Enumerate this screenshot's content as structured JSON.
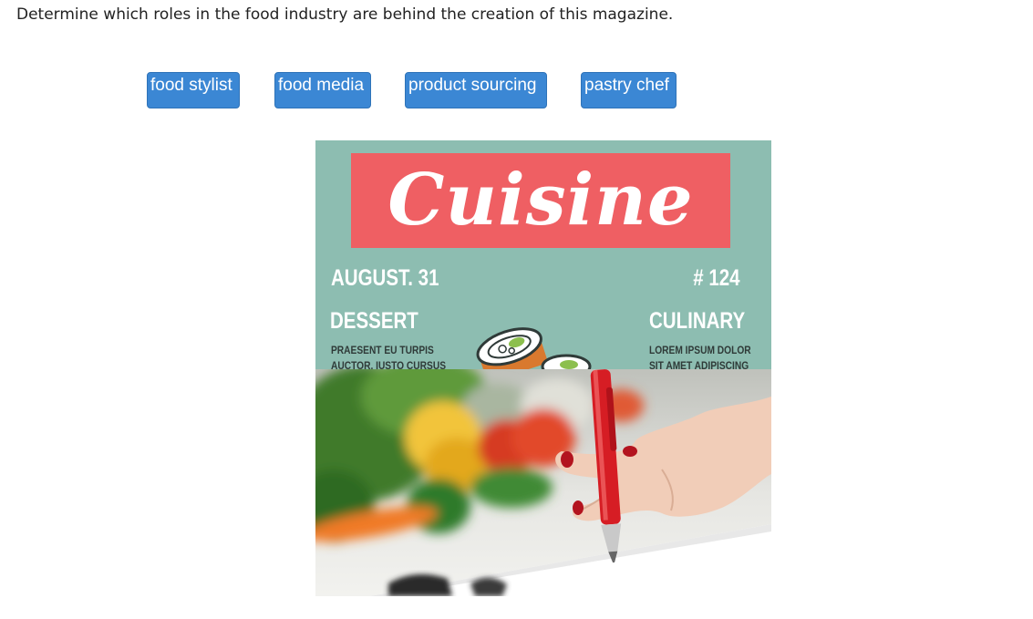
{
  "question": {
    "prompt": "Determine which roles in the food industry are behind the creation of this magazine."
  },
  "choices": [
    {
      "label": "food stylist"
    },
    {
      "label": "food media"
    },
    {
      "label": "product sourcing"
    },
    {
      "label": "pastry chef"
    }
  ],
  "cover": {
    "title": "Cuisine",
    "date": "AUGUST. 31",
    "issue": "# 124",
    "left_heading": "DESSERT",
    "left_sub_line1": "PRAESENT EU TURPIS",
    "left_sub_line2": "AUCTOR, IUSTO CURSUS",
    "right_heading": "CULINARY",
    "right_sub_line1": "LOREM IPSUM DOLOR",
    "right_sub_line2": "SIT AMET ADIPISCING"
  },
  "colors": {
    "button": "#3b87d4",
    "cover_bg": "#8dbdb1",
    "banner": "#ef5f63"
  }
}
